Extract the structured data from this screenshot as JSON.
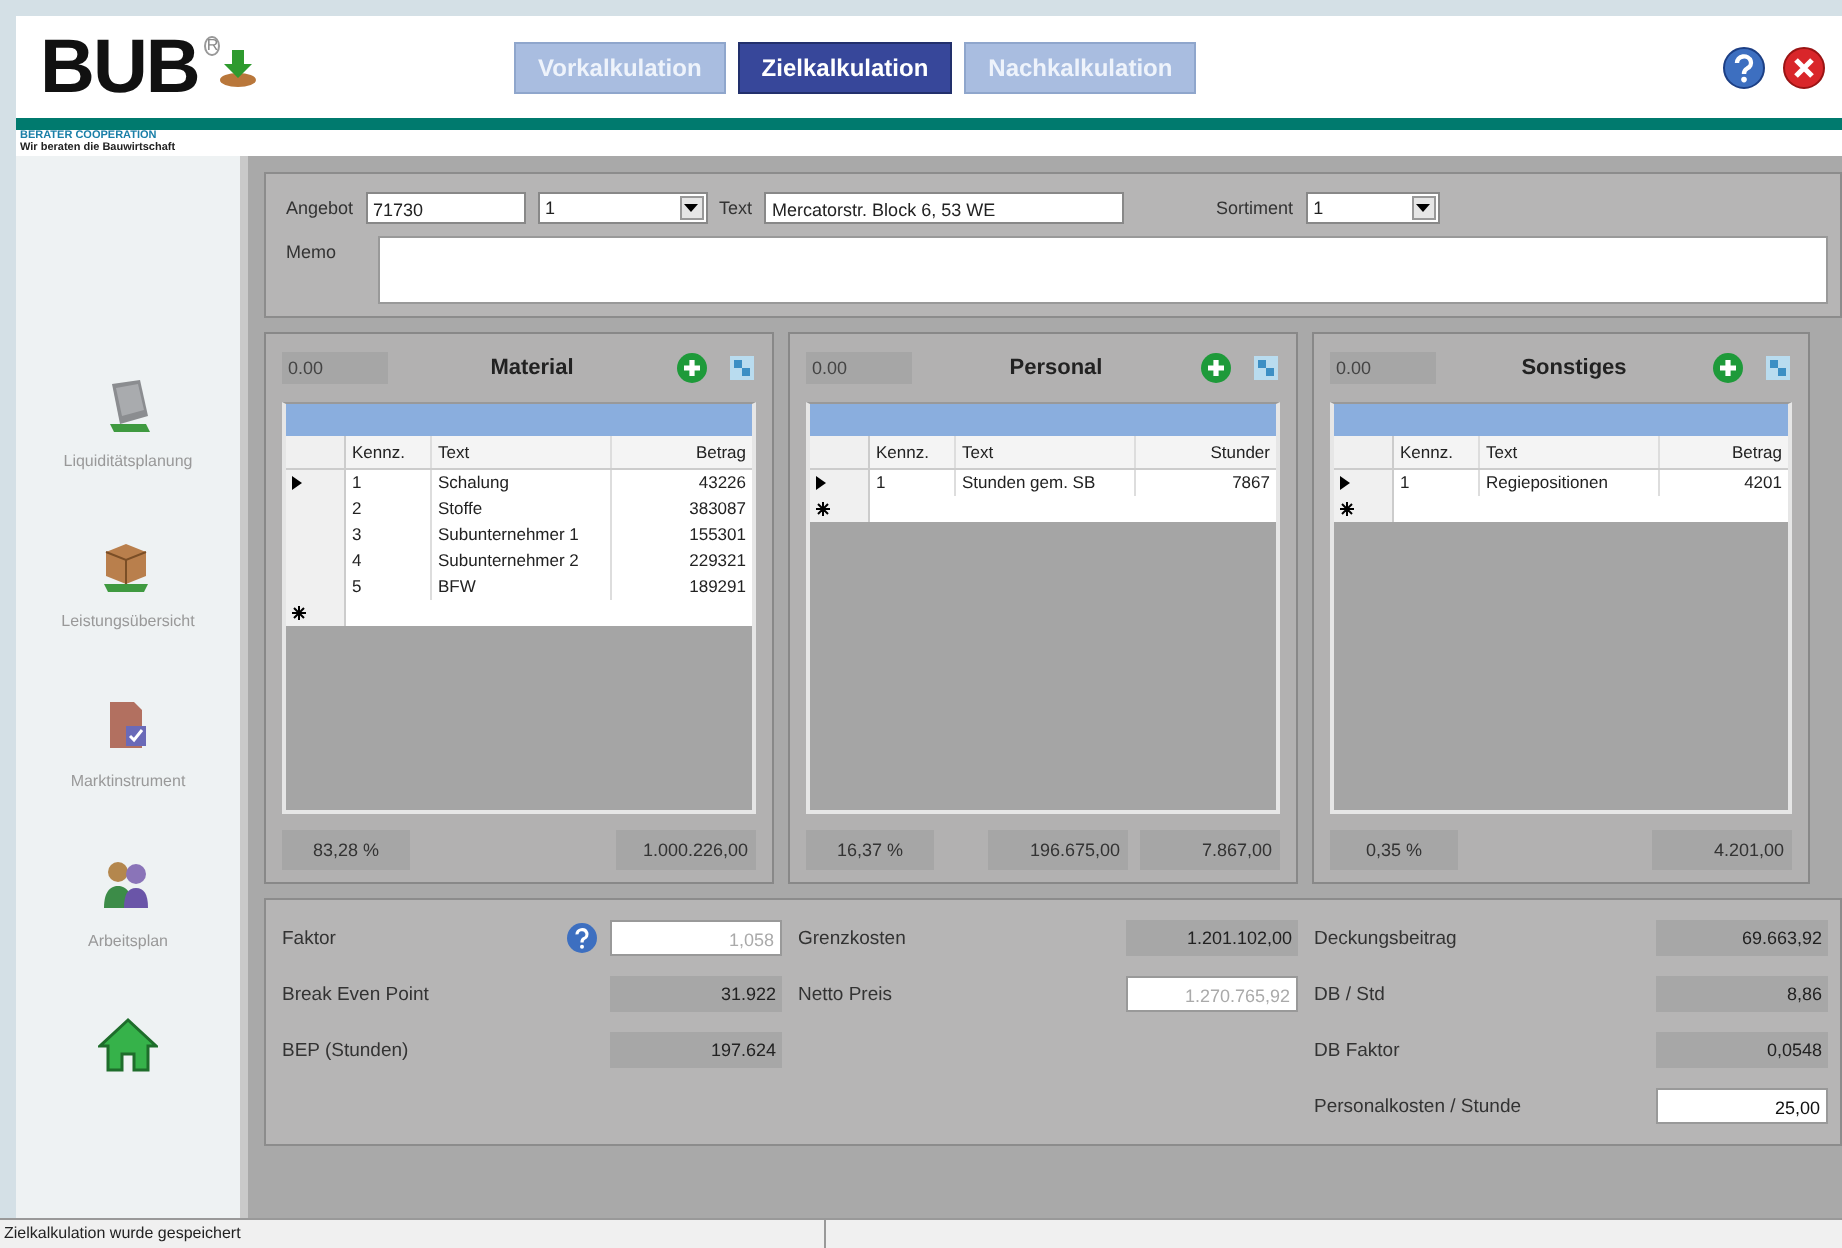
{
  "header": {
    "logo": "BUB",
    "logo_mark": "R",
    "company": "BERATER COOPERATION",
    "tagline": "Wir beraten die Bauwirtschaft"
  },
  "tabs": [
    {
      "label": "Vorkalkulation",
      "selected": false
    },
    {
      "label": "Zielkalkulation",
      "selected": true
    },
    {
      "label": "Nachkalkulation",
      "selected": false
    }
  ],
  "form": {
    "angebot_label": "Angebot",
    "angebot_value": "71730",
    "variant_value": "1",
    "text_label": "Text",
    "text_value": "Mercatorstr. Block 6, 53 WE",
    "sortiment_label": "Sortiment",
    "sortiment_value": "1",
    "memo_label": "Memo"
  },
  "sidebar": {
    "items": [
      {
        "kind": "monitor",
        "label": "Liquiditätsplanung"
      },
      {
        "kind": "boxes",
        "label": "Leistungsübersicht"
      },
      {
        "kind": "document",
        "label": "Marktinstrument"
      },
      {
        "kind": "people",
        "label": "Arbeitsplan"
      },
      {
        "kind": "home"
      }
    ]
  },
  "panels": [
    {
      "header_value": "0.00",
      "title": "Material",
      "columns": [
        "Kennz.",
        "Text",
        "Betrag"
      ],
      "rows": [
        {
          "current": true,
          "cells": [
            "1",
            "Schalung",
            "43226"
          ]
        },
        {
          "current": false,
          "cells": [
            "2",
            "Stoffe",
            "383087"
          ]
        },
        {
          "current": false,
          "cells": [
            "3",
            "Subunternehmer 1",
            "155301"
          ]
        },
        {
          "current": false,
          "cells": [
            "4",
            "Subunternehmer 2",
            "229321"
          ]
        },
        {
          "current": false,
          "cells": [
            "5",
            "BFW",
            "189291"
          ]
        }
      ],
      "footer": [
        "83,28 %",
        "1.000.226,00"
      ]
    },
    {
      "header_value": "0.00",
      "title": "Personal",
      "columns": [
        "Kennz.",
        "Text",
        "Stunder"
      ],
      "rows": [
        {
          "current": true,
          "cells": [
            "1",
            "Stunden gem. SB",
            "7867"
          ]
        }
      ],
      "footer": [
        "16,37 %",
        "196.675,00",
        "7.867,00"
      ]
    },
    {
      "header_value": "0.00",
      "title": "Sonstiges",
      "columns": [
        "Kennz.",
        "Text",
        "Betrag"
      ],
      "rows": [
        {
          "current": true,
          "cells": [
            "1",
            "Regiepositionen",
            "4201"
          ]
        }
      ],
      "footer": [
        "0,35 %",
        "4.201,00"
      ]
    }
  ],
  "summary": [
    [
      {
        "kind": "input",
        "label": "Faktor",
        "value": "1,058",
        "help": true,
        "disabled": true
      },
      {
        "kind": "readonly",
        "label": "Break Even Point",
        "value": "31.922"
      },
      {
        "kind": "readonly",
        "label": "BEP (Stunden)",
        "value": "197.624"
      }
    ],
    [
      {
        "kind": "readonly",
        "label": "Grenzkosten",
        "value": "1.201.102,00"
      },
      {
        "kind": "input",
        "label": "Netto Preis",
        "value": "1.270.765,92",
        "disabled": true
      }
    ],
    [
      {
        "kind": "readonly",
        "label": "Deckungsbeitrag",
        "value": "69.663,92"
      },
      {
        "kind": "readonly",
        "label": "DB / Std",
        "value": "8,86"
      },
      {
        "kind": "readonly",
        "label": "DB Faktor",
        "value": "0,0548"
      },
      {
        "kind": "input",
        "label": "Personalkosten / Stunde",
        "value": "25,00",
        "disabled": false
      }
    ]
  ],
  "status_bar": {
    "message": "Zielkalkulation wurde gespeichert"
  }
}
